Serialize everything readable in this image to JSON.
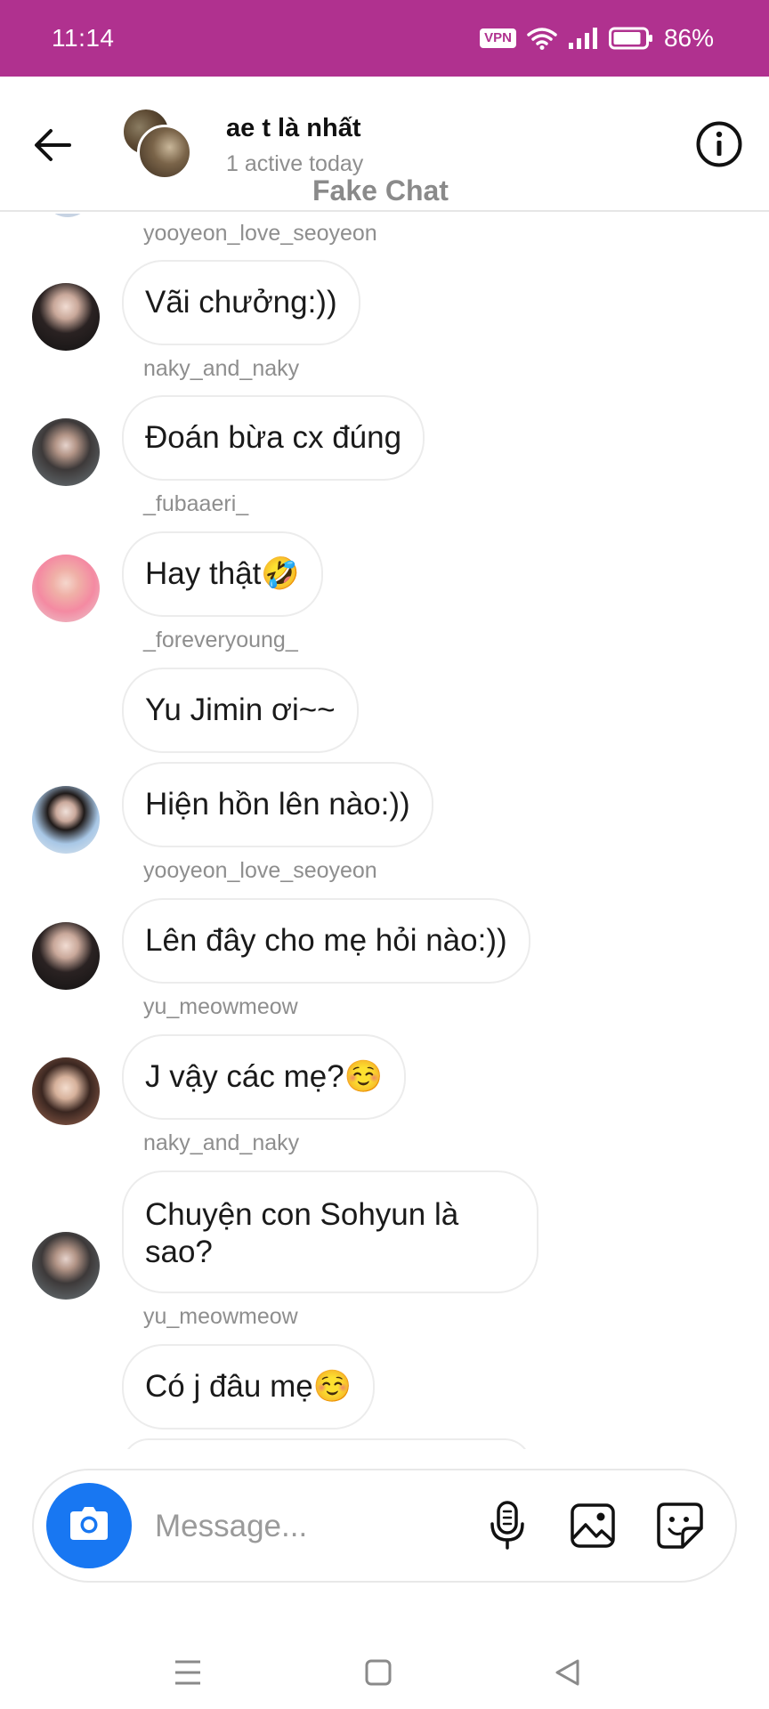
{
  "status_bar": {
    "time": "11:14",
    "vpn": "VPN",
    "battery": "86%",
    "background": "#b0318f"
  },
  "header": {
    "title": "ae t là nhất",
    "subtitle": "1 active today",
    "watermark": "Fake Chat"
  },
  "messages": [
    {
      "sender": "yooyeon_love_seoyeon",
      "text": "Vãi chưởng:))"
    },
    {
      "sender": "naky_and_naky",
      "text": "Đoán bừa cx đúng"
    },
    {
      "sender": "_fubaaeri_",
      "text": "Hay thật🤣"
    },
    {
      "sender": "_foreveryoung_",
      "text": "Yu Jimin ơi~~"
    },
    {
      "sender": "",
      "text": "Hiện hồn lên nào:))"
    },
    {
      "sender": "yooyeon_love_seoyeon",
      "text": "Lên đây cho mẹ hỏi nào:))"
    },
    {
      "sender": "yu_meowmeow",
      "text": "J vậy các mẹ?☺️"
    },
    {
      "sender": "naky_and_naky",
      "text": "Chuyện con Sohyun là sao?"
    },
    {
      "sender": "yu_meowmeow",
      "text": "Có j đâu mẹ☺️"
    }
  ],
  "composer": {
    "placeholder": "Message...",
    "accent": "#1877f2"
  },
  "icons": [
    "back-arrow-icon",
    "info-icon",
    "camera-icon",
    "microphone-icon",
    "gallery-icon",
    "sticker-icon",
    "menu-icon",
    "home-icon",
    "nav-back-icon"
  ]
}
